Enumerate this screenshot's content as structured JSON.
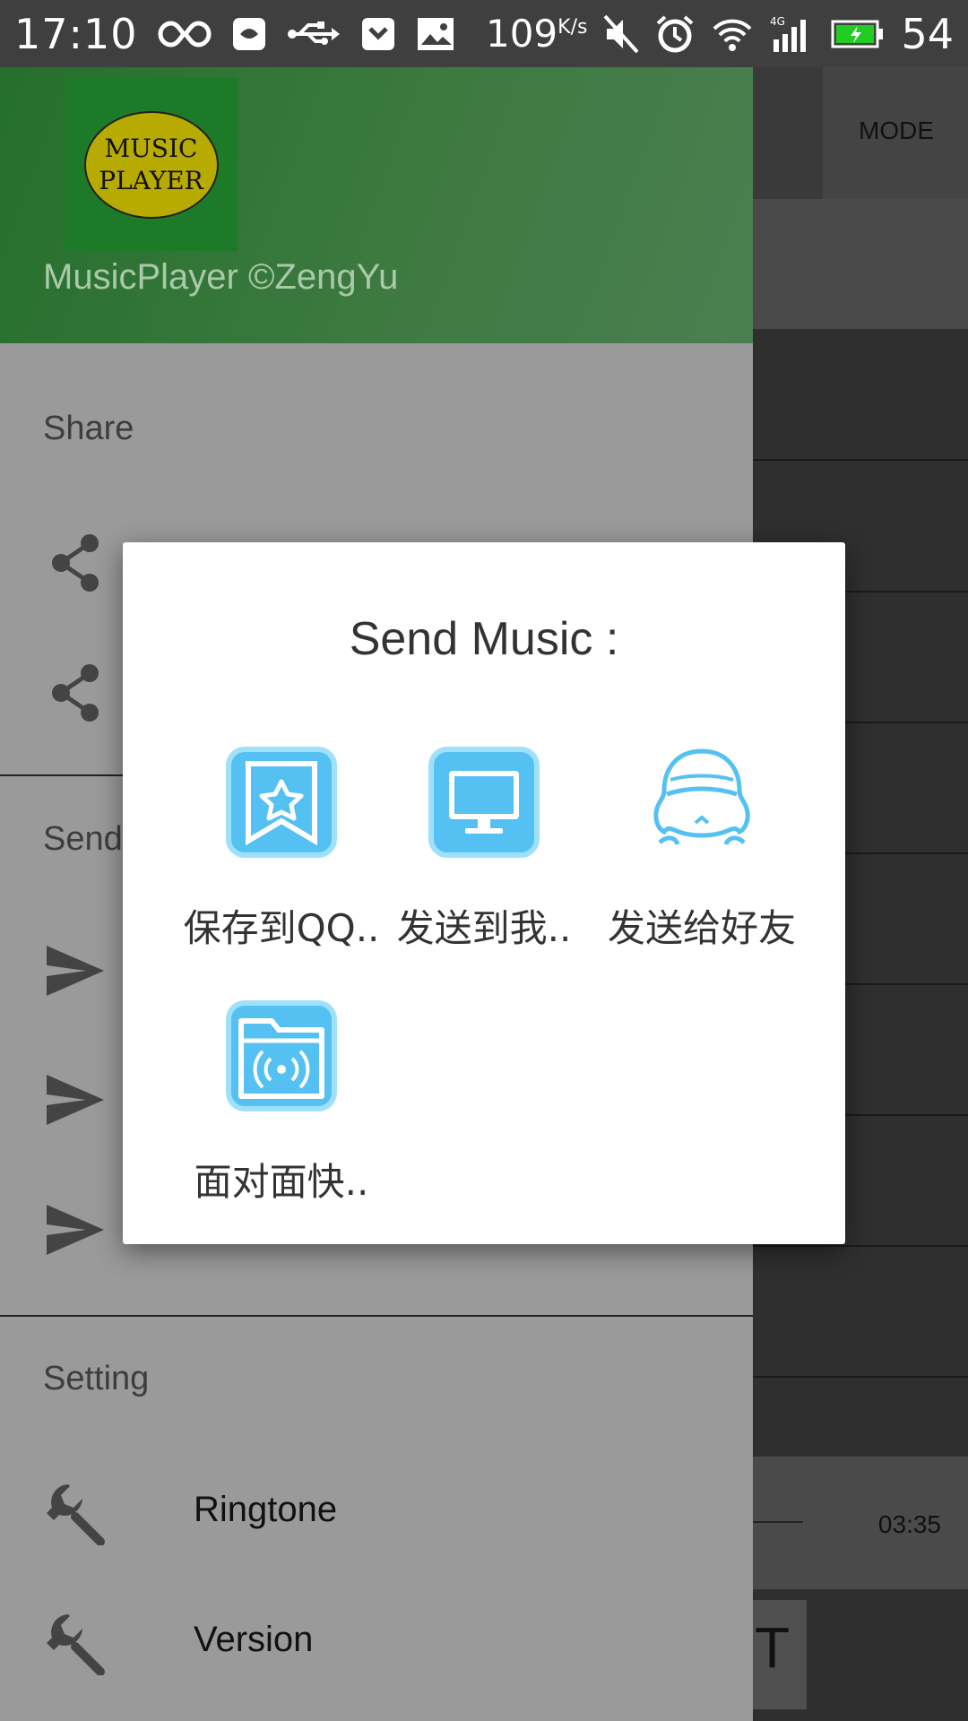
{
  "status_bar": {
    "time": "17:10",
    "speed_value": "109",
    "speed_unit": "K/s",
    "battery": "54"
  },
  "background": {
    "mode_label": "MODE",
    "duration": "03:35",
    "button_text": "T"
  },
  "drawer": {
    "app_title": "MusicPlayer ©ZengYu",
    "logo_line1": "MUSIC",
    "logo_line2": "PLAYER",
    "section_share": "Share",
    "section_send": "Send",
    "section_setting": "Setting",
    "settings_items": [
      {
        "label": "Ringtone",
        "icon": "wrench-icon"
      },
      {
        "label": "Version",
        "icon": "wrench-icon"
      }
    ]
  },
  "dialog": {
    "title": "Send Music :",
    "targets": [
      {
        "label": "保存到QQ..",
        "icon": "qq-favorite-icon"
      },
      {
        "label": "发送到我..",
        "icon": "computer-icon"
      },
      {
        "label": "发送给好友",
        "icon": "qq-penguin-icon"
      },
      {
        "label": "面对面快..",
        "icon": "folder-wireless-icon"
      }
    ]
  },
  "colors": {
    "header_green": "#256f2c",
    "drawer_gray": "#9a9a9a",
    "icon_blue": "#4dbdf0"
  }
}
